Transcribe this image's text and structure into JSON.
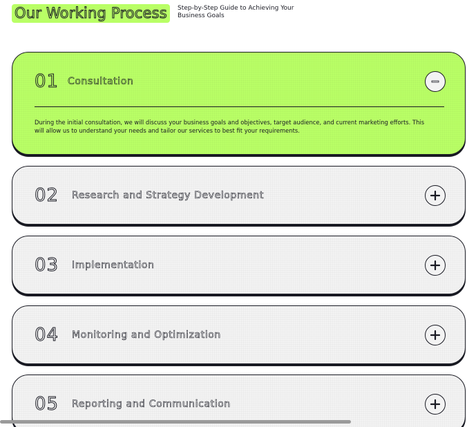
{
  "header": {
    "title": "Our Working Process",
    "subtitle": "Step-by-Step Guide to Achieving Your Business Goals"
  },
  "colors": {
    "accent": "#b9ff66",
    "dark": "#191a23",
    "card": "#f3f3f3"
  },
  "steps": [
    {
      "number": "01",
      "title": "Consultation",
      "expanded": true,
      "toggle_icon": "minus-icon",
      "body": "During the initial consultation, we will discuss your business goals and objectives, target audience, and current marketing efforts. This will allow us to understand your needs and tailor our services to best fit your requirements."
    },
    {
      "number": "02",
      "title": "Research and Strategy Development",
      "expanded": false,
      "toggle_icon": "plus-icon"
    },
    {
      "number": "03",
      "title": "Implementation",
      "expanded": false,
      "toggle_icon": "plus-icon"
    },
    {
      "number": "04",
      "title": "Monitoring and Optimization",
      "expanded": false,
      "toggle_icon": "plus-icon"
    },
    {
      "number": "05",
      "title": "Reporting and Communication",
      "expanded": false,
      "toggle_icon": "plus-icon"
    }
  ]
}
